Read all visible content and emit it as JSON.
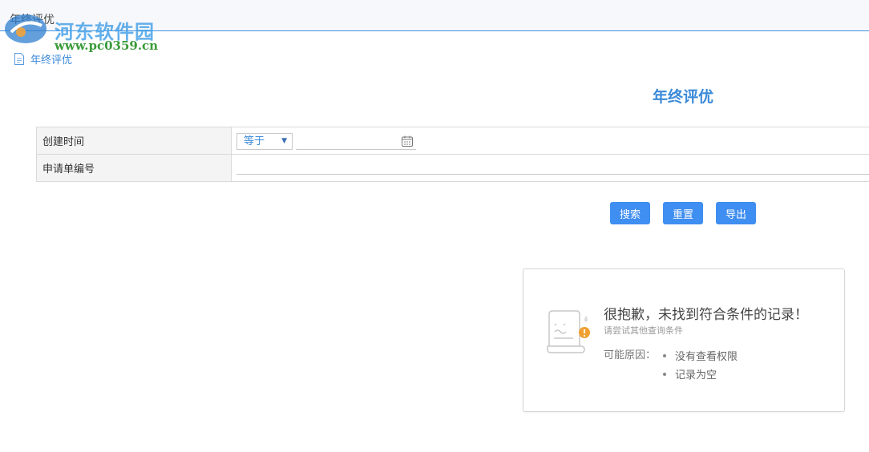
{
  "topbar": {
    "tab_label": "年终评优"
  },
  "watermark": {
    "site_name": "河东软件园",
    "url": "www.pc0359.cn"
  },
  "breadcrumb": {
    "label": "年终评优"
  },
  "page": {
    "title": "年终评优"
  },
  "filter": {
    "rows": [
      {
        "label": "创建时间",
        "operator": "等于",
        "date_value": ""
      },
      {
        "label": "申请单编号",
        "value": ""
      }
    ]
  },
  "actions": {
    "search": "搜索",
    "reset": "重置",
    "export": "导出"
  },
  "empty_state": {
    "heading": "很抱歉，未找到符合条件的记录！",
    "subheading": "请尝试其他查询条件",
    "reason_label": "可能原因：",
    "reasons": [
      "没有查看权限",
      "记录为空"
    ]
  },
  "colors": {
    "accent": "#3f8ef1",
    "title_blue": "#3b8ad9",
    "warning": "#f0a030"
  }
}
